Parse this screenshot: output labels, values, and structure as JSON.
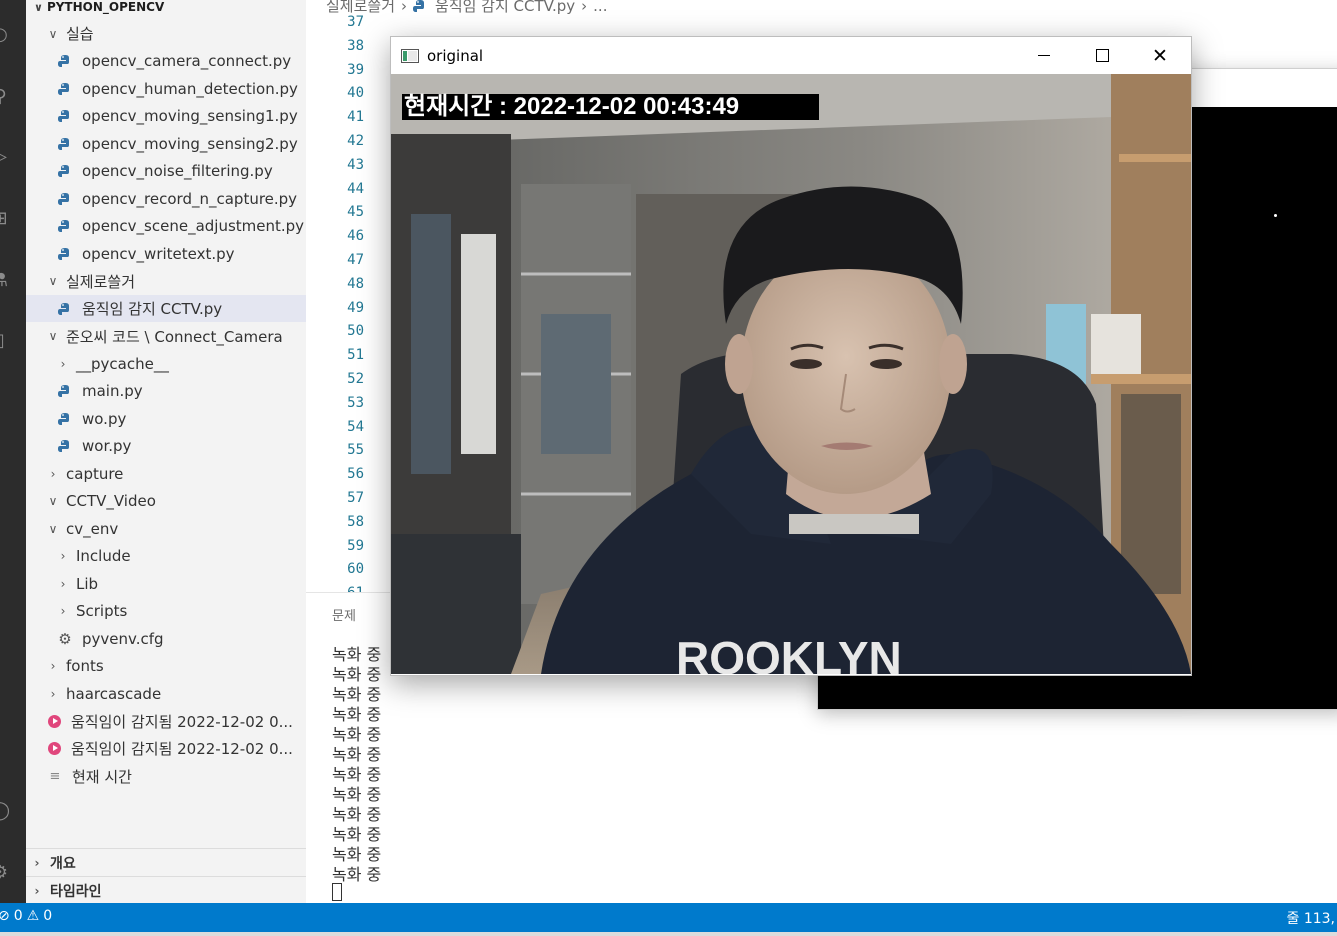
{
  "explorer": {
    "title": "PYTHON_OPENCV",
    "items": [
      {
        "label": "실습",
        "kind": "folder-open",
        "indent": 1
      },
      {
        "label": "opencv_camera_connect.py",
        "kind": "py",
        "indent": 2
      },
      {
        "label": "opencv_human_detection.py",
        "kind": "py",
        "indent": 2
      },
      {
        "label": "opencv_moving_sensing1.py",
        "kind": "py",
        "indent": 2
      },
      {
        "label": "opencv_moving_sensing2.py",
        "kind": "py",
        "indent": 2
      },
      {
        "label": "opencv_noise_filtering.py",
        "kind": "py",
        "indent": 2
      },
      {
        "label": "opencv_record_n_capture.py",
        "kind": "py",
        "indent": 2
      },
      {
        "label": "opencv_scene_adjustment.py",
        "kind": "py",
        "indent": 2
      },
      {
        "label": "opencv_writetext.py",
        "kind": "py",
        "indent": 2
      },
      {
        "label": "실제로쓸거",
        "kind": "folder-open",
        "indent": 1
      },
      {
        "label": "움직임 감지 CCTV.py",
        "kind": "py",
        "indent": 2,
        "selected": true
      },
      {
        "label": "준오씨 코드 \\ Connect_Camera",
        "kind": "folder-open",
        "indent": 1
      },
      {
        "label": "__pycache__",
        "kind": "folder-closed",
        "indent": 2
      },
      {
        "label": "main.py",
        "kind": "py",
        "indent": 2
      },
      {
        "label": "wo.py",
        "kind": "py",
        "indent": 2
      },
      {
        "label": "wor.py",
        "kind": "py",
        "indent": 2
      },
      {
        "label": "capture",
        "kind": "folder-closed",
        "indent": 1
      },
      {
        "label": "CCTV_Video",
        "kind": "folder-open",
        "indent": 1
      },
      {
        "label": "cv_env",
        "kind": "folder-open",
        "indent": 1
      },
      {
        "label": "Include",
        "kind": "folder-closed",
        "indent": 2
      },
      {
        "label": "Lib",
        "kind": "folder-closed",
        "indent": 2
      },
      {
        "label": "Scripts",
        "kind": "folder-closed",
        "indent": 2
      },
      {
        "label": "pyvenv.cfg",
        "kind": "cfg",
        "indent": 2
      },
      {
        "label": "fonts",
        "kind": "folder-closed",
        "indent": 1
      },
      {
        "label": "haarcascade",
        "kind": "folder-closed",
        "indent": 1
      },
      {
        "label": "움직임이 감지됨 2022-12-02 0...",
        "kind": "video",
        "indent": 1
      },
      {
        "label": "움직임이 감지됨 2022-12-02 0...",
        "kind": "video",
        "indent": 1
      },
      {
        "label": "현재 시간",
        "kind": "text",
        "indent": 1
      }
    ],
    "outline_label": "개요",
    "timeline_label": "타임라인"
  },
  "breadcrumb": {
    "part1": "실제로쓸거",
    "part2": "움직임 감지 CCTV.py",
    "part3": "..."
  },
  "line_numbers": [
    "37",
    "38",
    "39",
    "40",
    "41",
    "42",
    "43",
    "44",
    "45",
    "46",
    "47",
    "48",
    "49",
    "50",
    "51",
    "52",
    "53",
    "54",
    "55",
    "56",
    "57",
    "58",
    "59",
    "60",
    "61"
  ],
  "panel": {
    "tab_label": "문제",
    "terminal_lines": [
      "녹화 중",
      "녹화 중",
      "녹화 중",
      "녹화 중",
      "녹화 중",
      "녹화 중",
      "녹화 중",
      "녹화 중",
      "녹화 중",
      "녹화 중",
      "녹화 중",
      "녹화 중"
    ]
  },
  "window": {
    "title": "original",
    "minimize": "—",
    "maximize": "☐",
    "close": "✕",
    "overlay_text": "현재시간 : 2022-12-02 00:43:49"
  },
  "statusbar": {
    "errors": "0",
    "warnings": "0",
    "position": "줄 113,"
  },
  "colors": {
    "statusbar": "#007acc",
    "activitybar": "#2c2c2c",
    "sidebar": "#f3f3f3",
    "selection": "#e4e6f1",
    "line_number": "#237893",
    "video_icon": "#e0467c",
    "python_icon": "#3572a5"
  }
}
